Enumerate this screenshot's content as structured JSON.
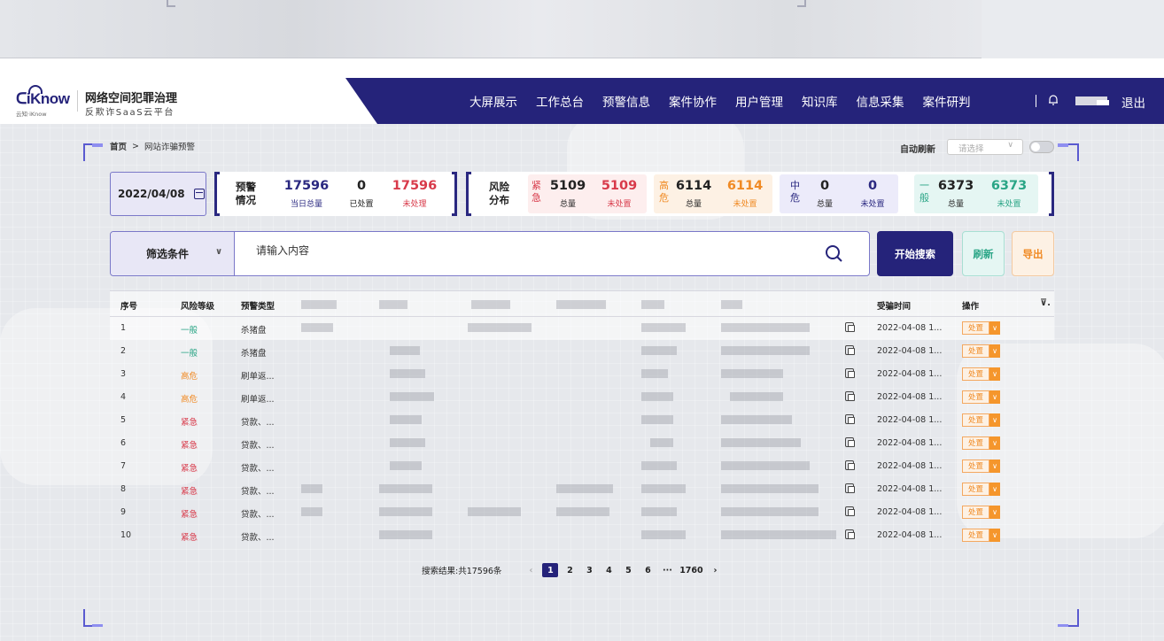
{
  "brand": {
    "logo_text": "iKnow",
    "logo_sub": "云知·iKnow",
    "title": "网络空间犯罪治理",
    "subtitle": "反欺诈SaaS云平台"
  },
  "nav": {
    "items": [
      "大屏展示",
      "工作总台",
      "预警信息",
      "案件协作",
      "用户管理",
      "知识库",
      "信息采集",
      "案件研判"
    ],
    "logout": "退出"
  },
  "breadcrumb": {
    "home": "首页",
    "separator": ">",
    "current": "网站诈骗预警"
  },
  "auto_refresh": {
    "label": "自动刷新",
    "placeholder": "请选择",
    "enabled": false
  },
  "date": "2022/04/08",
  "warning": {
    "label_line1": "预警",
    "label_line2": "情况",
    "total": "17596",
    "total_label": "当日总量",
    "handled": "0",
    "handled_label": "已处置",
    "unhandled": "17596",
    "unhandled_label": "未处理"
  },
  "risk": {
    "label_line1": "风险",
    "label_line2": "分布",
    "levels": [
      {
        "tag": "紧急",
        "total": "5109",
        "total_label": "总量",
        "pending": "5109",
        "pending_label": "未处置",
        "color": "#d83a4a",
        "bg": "#fdeeee"
      },
      {
        "tag": "高危",
        "total": "6114",
        "total_label": "总量",
        "pending": "6114",
        "pending_label": "未处置",
        "color": "#f08a24",
        "bg": "#fdf1e4"
      },
      {
        "tag": "中危",
        "total": "0",
        "total_label": "总量",
        "pending": "0",
        "pending_label": "未处置",
        "color": "#2a2880",
        "bg": "#ecebfa"
      },
      {
        "tag": "一般",
        "total": "6373",
        "total_label": "总量",
        "pending": "6373",
        "pending_label": "未处置",
        "color": "#2aa586",
        "bg": "#e5f6f3"
      }
    ]
  },
  "search": {
    "filter_label": "筛选条件",
    "placeholder": "请输入内容",
    "search_button": "开始搜索",
    "refresh_button": "刷新",
    "export_button": "导出"
  },
  "table": {
    "headers": {
      "index": "序号",
      "risk": "风险等级",
      "type": "预警类型",
      "time": "受骗时间",
      "op": "操作"
    },
    "action_label": "处置",
    "rows": [
      {
        "index": "1",
        "risk": "一般",
        "risk_color": "#2aa586",
        "type": "杀猪盘",
        "time": "2022-04-08 1..."
      },
      {
        "index": "2",
        "risk": "一般",
        "risk_color": "#2aa586",
        "type": "杀猪盘",
        "time": "2022-04-08 1..."
      },
      {
        "index": "3",
        "risk": "高危",
        "risk_color": "#f08a24",
        "type": "刷单返...",
        "time": "2022-04-08 1..."
      },
      {
        "index": "4",
        "risk": "高危",
        "risk_color": "#f08a24",
        "type": "刷单返...",
        "time": "2022-04-08 1..."
      },
      {
        "index": "5",
        "risk": "紧急",
        "risk_color": "#d83a4a",
        "type": "贷款、...",
        "time": "2022-04-08 1..."
      },
      {
        "index": "6",
        "risk": "紧急",
        "risk_color": "#d83a4a",
        "type": "贷款、...",
        "time": "2022-04-08 1..."
      },
      {
        "index": "7",
        "risk": "紧急",
        "risk_color": "#d83a4a",
        "type": "贷款、...",
        "time": "2022-04-08 1..."
      },
      {
        "index": "8",
        "risk": "紧急",
        "risk_color": "#d83a4a",
        "type": "贷款、...",
        "time": "2022-04-08 1..."
      },
      {
        "index": "9",
        "risk": "紧急",
        "risk_color": "#d83a4a",
        "type": "贷款、...",
        "time": "2022-04-08 1..."
      },
      {
        "index": "10",
        "risk": "紧急",
        "risk_color": "#d83a4a",
        "type": "贷款、...",
        "time": "2022-04-08 1..."
      }
    ]
  },
  "pagination": {
    "total_text": "搜索结果:共17596条",
    "pages": [
      "1",
      "2",
      "3",
      "4",
      "5",
      "6",
      "···",
      "1760"
    ],
    "current": "1"
  }
}
